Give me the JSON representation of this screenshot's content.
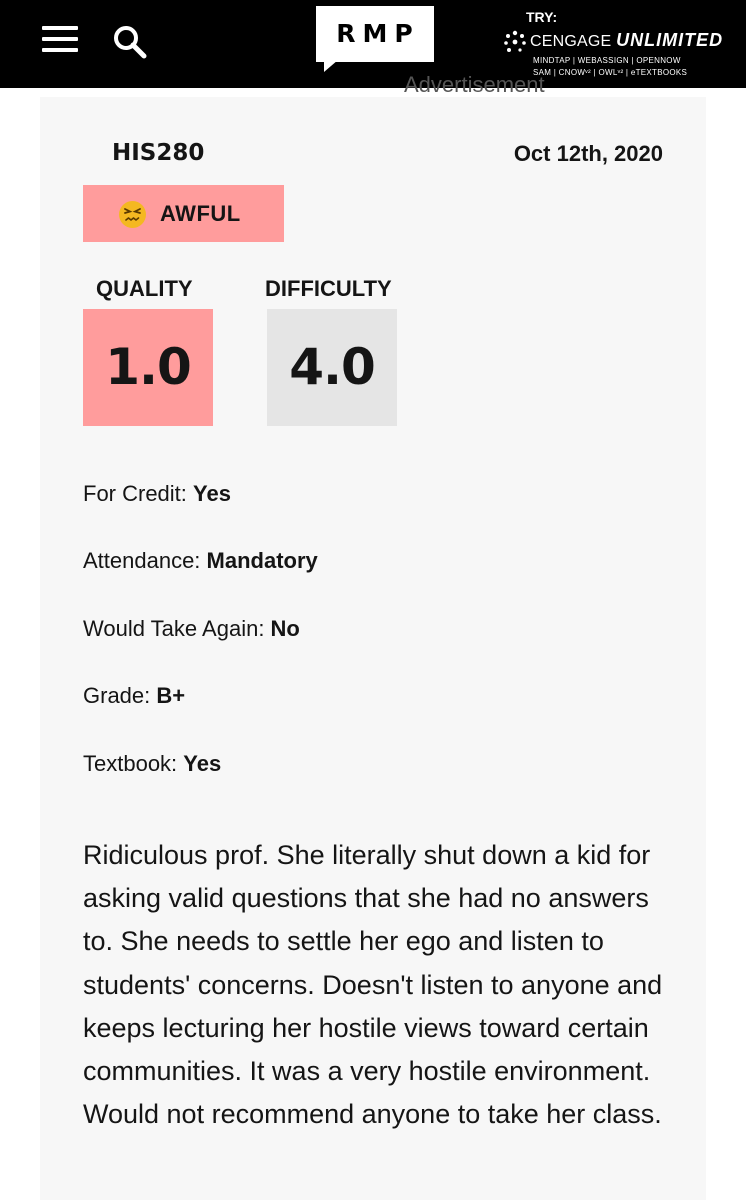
{
  "header": {
    "logo_text": "RMP",
    "ad": {
      "try_label": "TRY:",
      "brand": "CENGAGE",
      "brand_bold": "UNLIMITED",
      "products_line1": "MINDTAP | WEBASSIGN | OPENNOW",
      "products_line2": "SAM | CNOWᵛ² | OWLᵛ² | eTEXTBOOKS"
    },
    "icons": {
      "menu": "hamburger-menu-icon",
      "search": "search-icon",
      "ad": "cengage-logo-icon"
    }
  },
  "advertisement_label": "Advertisement",
  "rating": {
    "course": "HIS280",
    "date": "Oct 12th, 2020",
    "emotion_label": "AWFUL",
    "emotion_icon": "angry-face-icon",
    "quality_label": "QUALITY",
    "quality_value": "1.0",
    "difficulty_label": "DIFFICULTY",
    "difficulty_value": "4.0",
    "details": [
      {
        "label": "For Credit: ",
        "value": "Yes"
      },
      {
        "label": "Attendance: ",
        "value": "Mandatory"
      },
      {
        "label": "Would Take Again: ",
        "value": "No"
      },
      {
        "label": "Grade: ",
        "value": "B+"
      },
      {
        "label": "Textbook: ",
        "value": "Yes"
      }
    ],
    "comment": "Ridiculous prof. She literally shut down a kid for asking valid questions that she had no answers to. She needs to settle her ego and listen to students' concerns. Doesn't listen to anyone and keeps lecturing her hostile views toward certain communities. It was a very hostile environment. Would not recommend anyone to take her class."
  },
  "colors": {
    "topbar": "#000000",
    "awful_red": "#ff9c9c",
    "difficulty_gray": "#e5e5e5",
    "card_bg": "#f7f7f7"
  }
}
